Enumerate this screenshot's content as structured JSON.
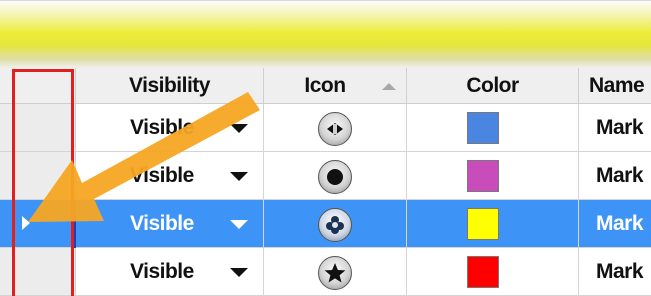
{
  "headers": {
    "visibility": "Visibility",
    "icon": "Icon",
    "color": "Color",
    "name": "Name"
  },
  "icon_sort_indicator": "sort-ascending-icon",
  "rows": [
    {
      "visibility": "Visible",
      "icon": "diamond-marker-icon",
      "color": "#4a86e0",
      "name": "Mark",
      "selected": false
    },
    {
      "visibility": "Visible",
      "icon": "circle-marker-icon",
      "color": "#c84dbb",
      "name": "Mark",
      "selected": false
    },
    {
      "visibility": "Visible",
      "icon": "flower-marker-icon",
      "color": "#ffff00",
      "name": "Mark",
      "selected": true
    },
    {
      "visibility": "Visible",
      "icon": "star-marker-icon",
      "color": "#ff0000",
      "name": "Mark",
      "selected": false
    }
  ],
  "colors": {
    "selection": "#3d94f6",
    "highlight_box": "#e02020",
    "annotation_arrow": "#f5a623",
    "title_bar": "#eded38"
  }
}
